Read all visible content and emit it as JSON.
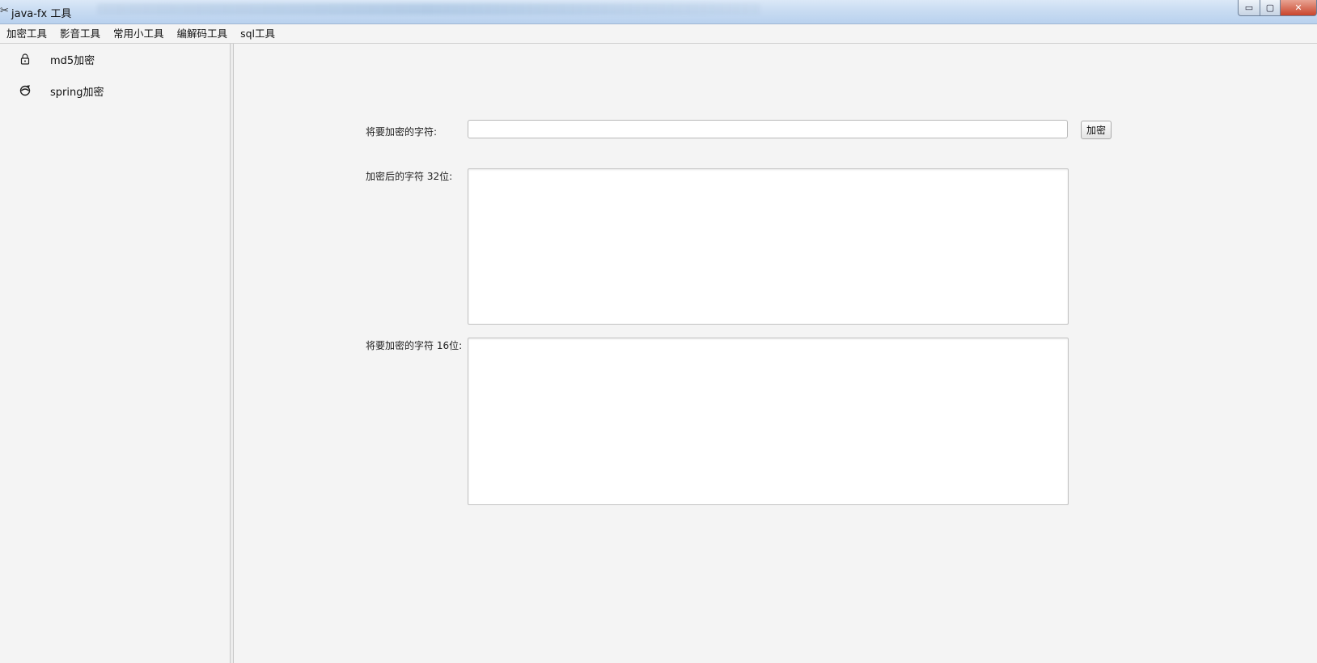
{
  "window": {
    "title": "java-fx 工具",
    "icon": "tools-icon",
    "controls": {
      "minimize": "▭",
      "maximize": "▢",
      "close": "✕"
    }
  },
  "menubar": {
    "items": [
      {
        "label": "加密工具"
      },
      {
        "label": "影音工具"
      },
      {
        "label": "常用小工具"
      },
      {
        "label": "编解码工具"
      },
      {
        "label": "sql工具"
      }
    ]
  },
  "sidebar": {
    "items": [
      {
        "label": "md5加密",
        "icon": "lock-icon",
        "glyph": "🔒"
      },
      {
        "label": "spring加密",
        "icon": "spring-icon",
        "glyph": "☯"
      }
    ]
  },
  "main": {
    "input_label": "将要加密的字符:",
    "input_value": "",
    "encrypt_button": "加密",
    "output32_label": "加密后的字符 32位:",
    "output32_value": "",
    "output16_label": "将要加密的字符 16位:",
    "output16_value": ""
  }
}
